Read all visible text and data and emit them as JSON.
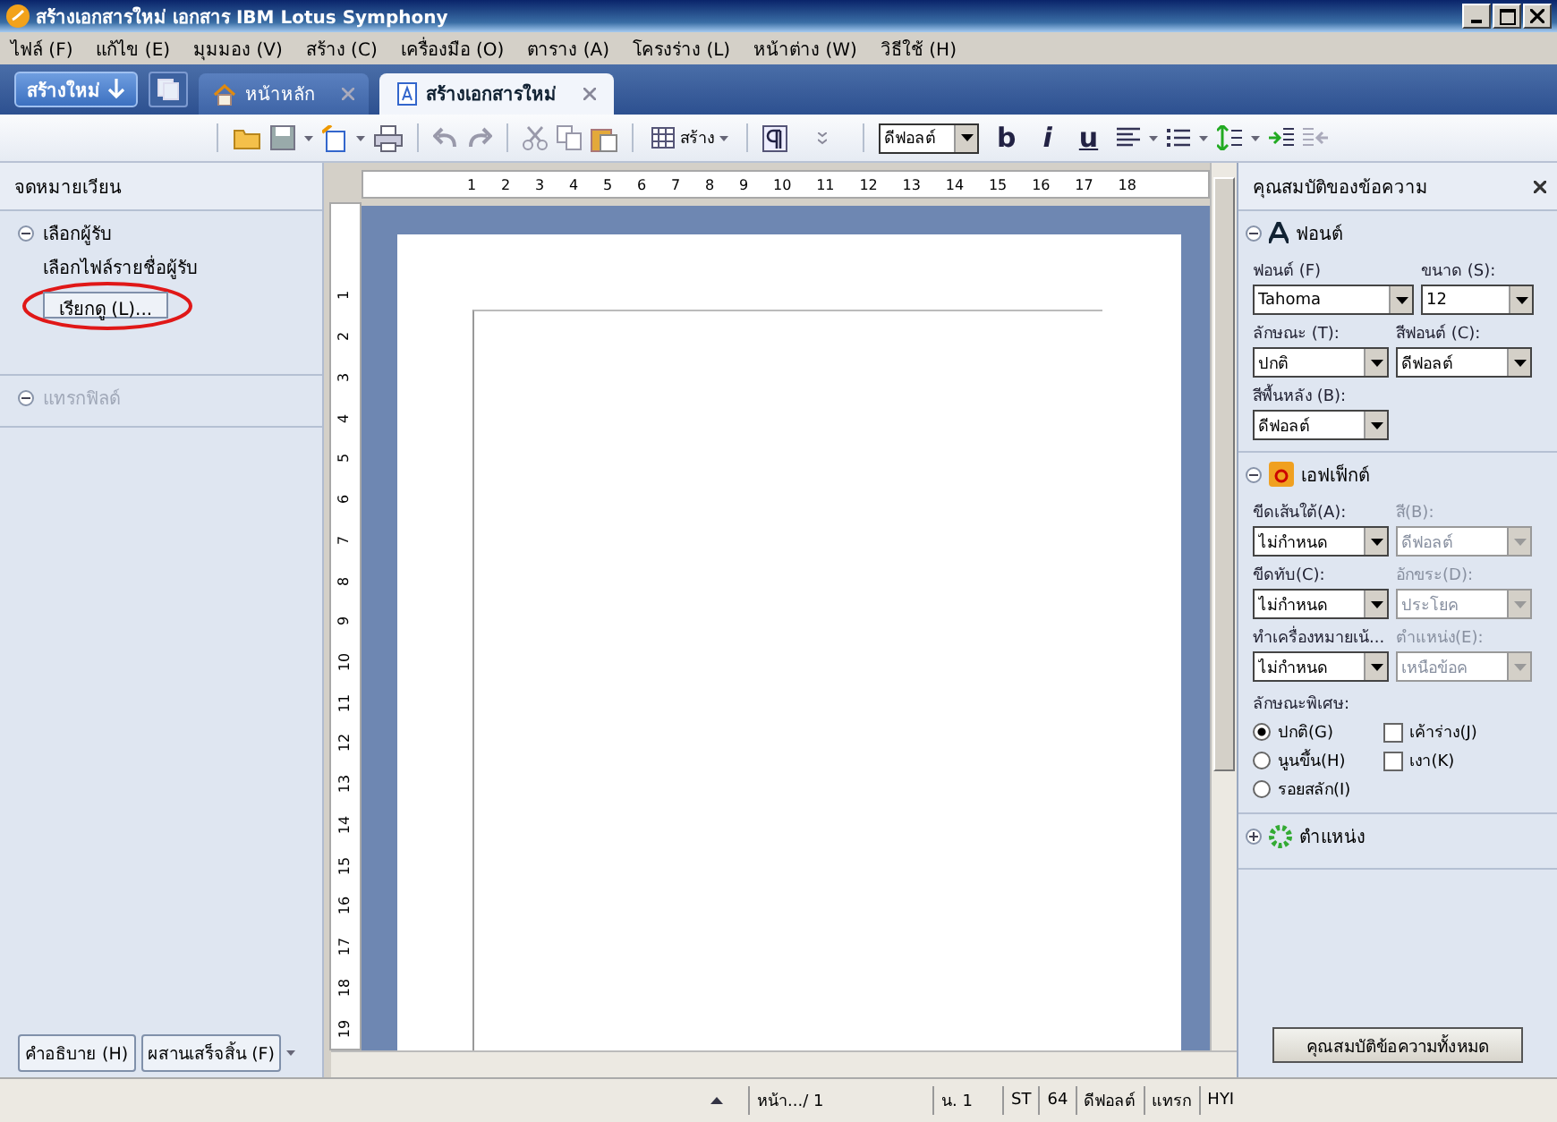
{
  "window": {
    "title": "สร้างเอกสารใหม่  เอกสาร  IBM Lotus Symphony"
  },
  "menu": [
    "ไฟล์ (F)",
    "แก้ไข (E)",
    "มุมมอง (V)",
    "สร้าง (C)",
    "เครื่องมือ (O)",
    "ตาราง (A)",
    "โครงร่าง (L)",
    "หน้าต่าง (W)",
    "วิธีใช้ (H)"
  ],
  "new_button": "สร้างใหม่",
  "tabs": [
    {
      "label": "หน้าหลัก",
      "kind": "home",
      "selected": false
    },
    {
      "label": "สร้างเอกสารใหม่",
      "kind": "doc",
      "selected": true
    }
  ],
  "toolbar": {
    "table_label": "สร้าง",
    "style_value": "ดีฟอลต์",
    "format_buttons": [
      "b",
      "i",
      "u"
    ]
  },
  "left_panel": {
    "title": "จดหมายเวียน",
    "sections": [
      {
        "label": "เลือกผู้รับ",
        "expanded": true,
        "disabled": false,
        "text": "เลือกไฟล์รายชื่อผู้รับ",
        "button": "เรียกดู (L)..."
      },
      {
        "label": "แทรกฟิลด์",
        "expanded": true,
        "disabled": true
      }
    ],
    "bottom_buttons": [
      "คำอธิบาย (H)",
      "ผสานเสร็จสิ้น (F)"
    ]
  },
  "ruler": {
    "h_numbers": [
      "1",
      "2",
      "3",
      "4",
      "5",
      "6",
      "7",
      "8",
      "9",
      "10",
      "11",
      "12",
      "13",
      "14",
      "15",
      "16",
      "17",
      "18"
    ],
    "v_numbers": [
      "1",
      "2",
      "3",
      "4",
      "5",
      "6",
      "7",
      "8",
      "9",
      "10",
      "11",
      "12",
      "13",
      "14",
      "15",
      "16",
      "17",
      "18",
      "19"
    ]
  },
  "right_panel": {
    "title": "คุณสมบัติของข้อความ",
    "font_section": {
      "label": "ฟอนต์",
      "expanded": true,
      "fields": [
        {
          "label": "ฟอนต์ (F)",
          "value": "Tahoma",
          "disabled": false,
          "kind": "wide"
        },
        {
          "label": "ขนาด (S):",
          "value": "12",
          "disabled": false,
          "kind": "narrow"
        },
        {
          "label": "ลักษณะ (T):",
          "value": "ปกติ",
          "disabled": false,
          "kind": "half"
        },
        {
          "label": "สีฟอนต์ (C):",
          "value": "ดีฟอลต์",
          "disabled": false,
          "kind": "half"
        },
        {
          "label": "สีพื้นหลัง (B):",
          "value": "ดีฟอลต์",
          "disabled": false,
          "kind": "half"
        }
      ]
    },
    "effects_section": {
      "label": "เอฟเฟ็กต์",
      "expanded": true,
      "fields": [
        {
          "label": "ขีดเส้นใต้(A):",
          "value": "ไม่กำหนด",
          "disabled": false,
          "kind": "half"
        },
        {
          "label": "สี(B):",
          "value": "ดีฟอลต์",
          "disabled": true,
          "kind": "half"
        },
        {
          "label": "ขีดทับ(C):",
          "value": "ไม่กำหนด",
          "disabled": false,
          "kind": "half"
        },
        {
          "label": "อักขระ(D):",
          "value": "ประโยค",
          "disabled": true,
          "kind": "half"
        },
        {
          "label": "ทำเครื่องหมายเน้...",
          "value": "ไม่กำหนด",
          "disabled": false,
          "kind": "half"
        },
        {
          "label": "ตำแหน่ง(E):",
          "value": "เหนือข้อค",
          "disabled": true,
          "kind": "half"
        }
      ],
      "style_label": "ลักษณะพิเศษ:",
      "radios": [
        {
          "label": "ปกติ(G)",
          "selected": true
        },
        {
          "label": "นูนขึ้น(H)",
          "selected": false
        },
        {
          "label": "รอยสลัก(I)",
          "selected": false
        }
      ],
      "checks": [
        {
          "label": "เค้าร่าง(J)",
          "checked": false
        },
        {
          "label": "เงา(K)",
          "checked": false
        }
      ]
    },
    "position_section": {
      "label": "ตำแหน่ง",
      "expanded": false
    },
    "all_button": "คุณสมบัติข้อความทั้งหมด"
  },
  "status_bar": [
    "หน้า.../ 1",
    "น. 1",
    "ST",
    "64",
    "ดีฟอลต์",
    "แทรก",
    "HYI"
  ]
}
